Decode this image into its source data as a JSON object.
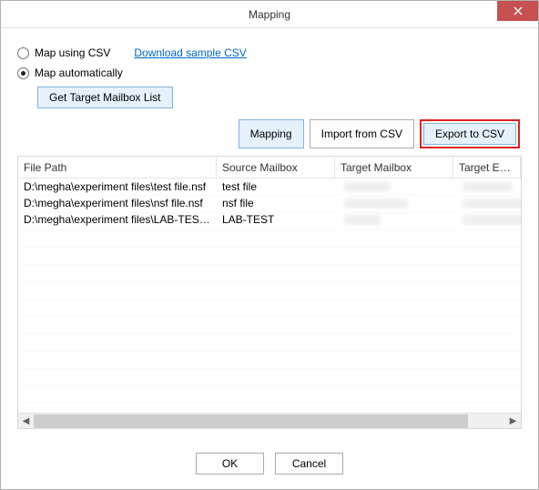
{
  "window": {
    "title": "Mapping"
  },
  "options": {
    "map_csv_label": "Map using CSV",
    "download_link": "Download sample CSV",
    "map_auto_label": "Map automatically",
    "selected": "auto",
    "get_target_label": "Get Target Mailbox List"
  },
  "actions": {
    "mapping": "Mapping",
    "import": "Import from CSV",
    "export": "Export to CSV"
  },
  "table": {
    "headers": {
      "file_path": "File Path",
      "source_mailbox": "Source Mailbox",
      "target_mailbox": "Target Mailbox",
      "target_email": "Target Email"
    },
    "rows": [
      {
        "file_path": "D:\\megha\\experiment files\\test file.nsf",
        "source_mailbox": "test file",
        "target_mailbox": "",
        "target_email": ""
      },
      {
        "file_path": "D:\\megha\\experiment files\\nsf file.nsf",
        "source_mailbox": "nsf file",
        "target_mailbox": "",
        "target_email": ""
      },
      {
        "file_path": "D:\\megha\\experiment files\\LAB-TEST...",
        "source_mailbox": "LAB-TEST",
        "target_mailbox": "",
        "target_email": ""
      }
    ]
  },
  "footer": {
    "ok": "OK",
    "cancel": "Cancel"
  }
}
